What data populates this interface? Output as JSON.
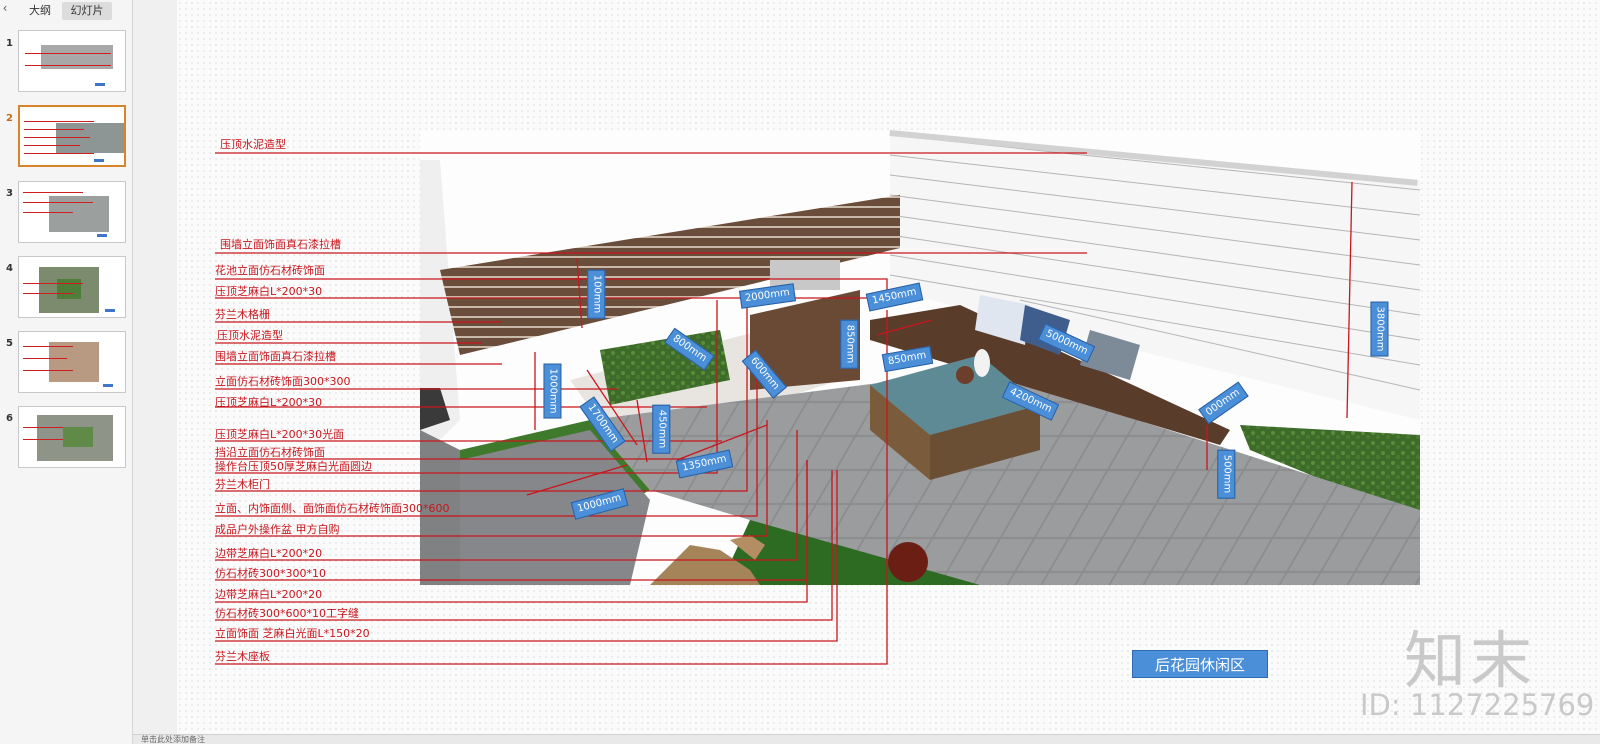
{
  "sidebar": {
    "tabs": [
      {
        "label": "大纲"
      },
      {
        "label": "幻灯片"
      }
    ],
    "slides": [
      {
        "number": "1"
      },
      {
        "number": "2"
      },
      {
        "number": "3"
      },
      {
        "number": "4"
      },
      {
        "number": "5"
      },
      {
        "number": "6"
      }
    ],
    "active_slide": 2
  },
  "notes_hint": "单击此处添加备注",
  "slide": {
    "title_box": "后花园休闲区",
    "callouts": [
      "压顶水泥造型",
      "围墙立面饰面真石漆拉槽",
      "花池立面仿石材砖饰面",
      "压顶芝麻白L*200*30",
      "芬兰木格栅",
      "压顶水泥造型",
      "围墙立面饰面真石漆拉槽",
      "立面仿石材砖饰面300*300",
      "压顶芝麻白L*200*30",
      "压顶芝麻白L*200*30光面",
      "挡沿立面仿石材砖饰面",
      "操作台压顶50厚芝麻白光面圆边",
      "芬兰木柜门",
      "立面、内饰面侧、面饰面仿石材砖饰面300*600",
      "成品户外操作盆 甲方自购",
      "边带芝麻白L*200*20",
      "仿石材砖300*300*10",
      "边带芝麻白L*200*20",
      "仿石材砖300*600*10工字缝",
      "立面饰面 芝麻白光面L*150*20",
      "芬兰木座板"
    ],
    "dimensions": [
      "100mm",
      "2000mm",
      "1450mm",
      "800mm",
      "850mm",
      "600mm",
      "850mm",
      "5000mm",
      "1000mm",
      "1700mm",
      "450mm",
      "4200mm",
      "000mm",
      "1350mm",
      "1000mm",
      "500mm",
      "3800mm"
    ]
  },
  "watermark": {
    "logo": "知末",
    "id": "ID: 1127225769"
  },
  "colors": {
    "callout_red": "#c8161d",
    "dim_blue": "#4a8fd8",
    "active_border": "#d9842b"
  }
}
